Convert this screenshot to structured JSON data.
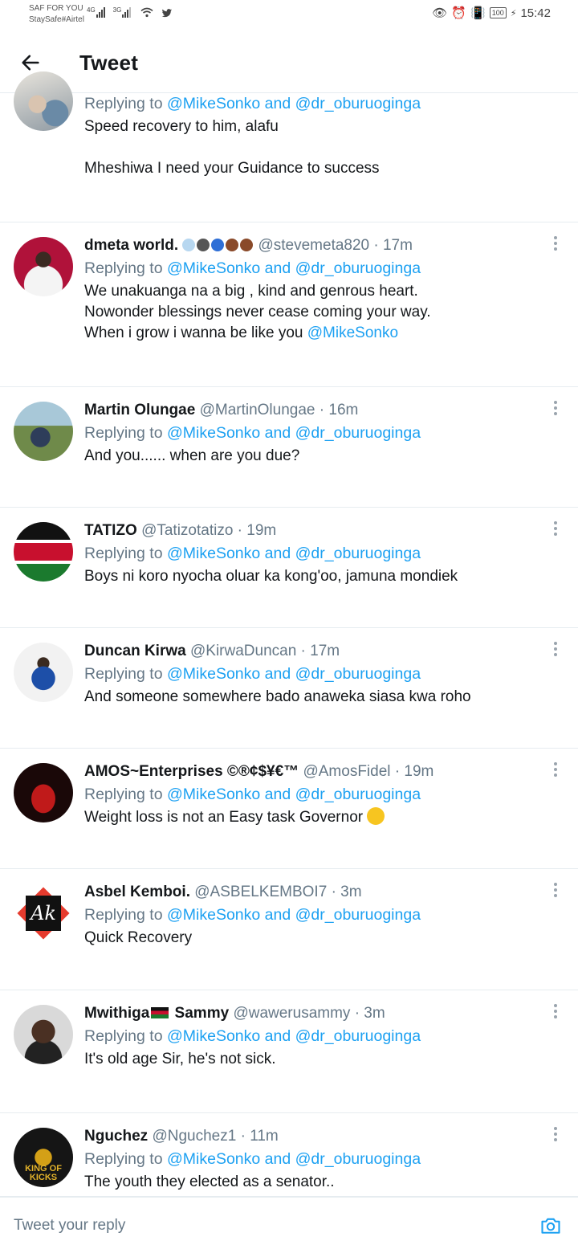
{
  "status": {
    "carrier_line1": "SAF FOR YOU",
    "carrier_line2": "StaySafe#Airtel",
    "net1": "4G",
    "net2": "3G",
    "battery": "100",
    "time": "15:42"
  },
  "header": {
    "title": "Tweet"
  },
  "replying_prefix": "Replying to ",
  "replying_to_1": "@MikeSonko",
  "replying_and": " and ",
  "replying_to_2": "@dr_oburuoginga",
  "tweets": [
    {
      "name": "",
      "handle": "",
      "time": "",
      "lines": [
        "Speed recovery to him, alafu",
        "",
        "Mheshiwa I need your Guidance to success"
      ]
    },
    {
      "name": "dmeta world.",
      "handle": "@stevemeta820",
      "time": " · 17m",
      "lines": [
        "We unakuanga na a big , kind and genrous heart.",
        "Nowonder  blessings never cease coming your way.",
        "When i grow i wanna be like you "
      ],
      "mention": "@MikeSonko"
    },
    {
      "name": "Martin Olungae",
      "handle": "@MartinOlungae",
      "time": " · 16m",
      "lines": [
        "And you...... when are you due?"
      ]
    },
    {
      "name": "TATIZO",
      "handle": "@Tatizotatizo",
      "time": " · 19m",
      "lines": [
        "Boys ni koro nyocha oluar ka kong'oo, jamuna mondiek"
      ]
    },
    {
      "name": "Duncan Kirwa",
      "handle": "@KirwaDuncan",
      "time": " · 17m",
      "lines": [
        "And someone somewhere bado anaweka siasa kwa roho"
      ]
    },
    {
      "name": "AMOS~Enterprises ©®¢$¥€™",
      "handle": "@AmosFidel",
      "time": " · 19m",
      "lines": [
        "Weight loss is not an Easy task Governor "
      ]
    },
    {
      "name": "Asbel Kemboi.",
      "handle": "@ASBELKEMBOI7",
      "time": " · 3m",
      "lines": [
        "Quick Recovery"
      ],
      "avatar_text": "Ak"
    },
    {
      "name": "Mwithiga",
      "name2": " Sammy",
      "handle": "@wawerusammy",
      "time": " · 3m",
      "lines": [
        "It's old age Sir, he's not sick."
      ]
    },
    {
      "name": "Nguchez",
      "handle": "@Nguchez1",
      "time": " · 11m",
      "lines": [
        "The youth they elected as a senator.."
      ],
      "avatar_text": "KING OF KICKS"
    }
  ],
  "reply_placeholder": "Tweet your reply",
  "icons": {
    "back": "arrow-left-icon",
    "reply": "comment-icon",
    "retweet": "retweet-icon",
    "like": "heart-icon",
    "share": "share-icon",
    "more": "more-vertical-icon",
    "camera": "camera-icon"
  },
  "colors": {
    "link": "#1da1f2",
    "secondary": "#657786",
    "icon": "#657786",
    "divider": "#e6ecf0"
  }
}
